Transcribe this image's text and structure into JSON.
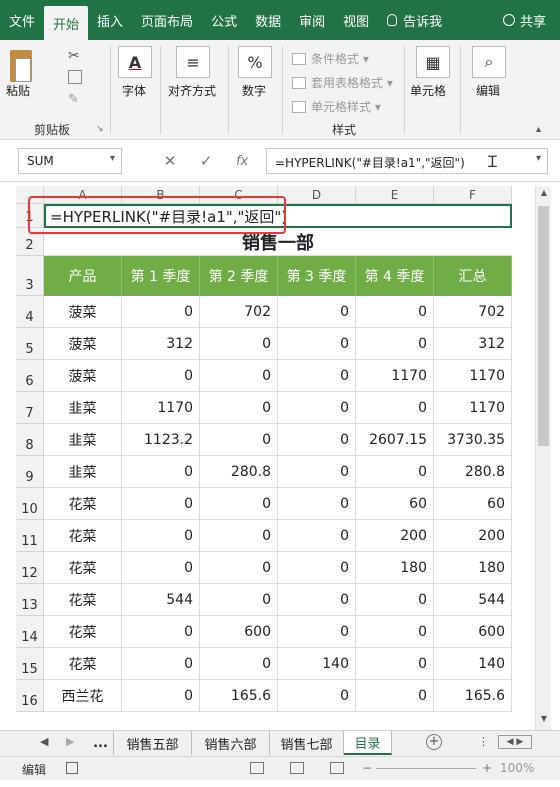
{
  "ribbon_tabs": [
    "文件",
    "开始",
    "插入",
    "页面布局",
    "公式",
    "数据",
    "审阅",
    "视图",
    "告诉我"
  ],
  "share_label": "共享",
  "ribbon": {
    "paste": "粘贴",
    "clipboard": "剪贴板",
    "font": "字体",
    "align": "对齐方式",
    "number": "数字",
    "number_symbol": "%",
    "cond_format": "条件格式",
    "table_format": "套用表格格式",
    "cell_style": "单元格样式",
    "styles": "样式",
    "cells": "单元格",
    "editing": "编辑"
  },
  "formula_bar": {
    "name_box": "SUM",
    "fx": "fx",
    "formula": "=HYPERLINK(\"#目录!a1\",\"返回\")"
  },
  "columns": [
    "A",
    "B",
    "C",
    "D",
    "E",
    "F"
  ],
  "row_numbers": [
    "1",
    "2",
    "3",
    "4",
    "5",
    "6",
    "7",
    "8",
    "9",
    "10",
    "11",
    "12",
    "13",
    "14",
    "15",
    "16"
  ],
  "row1_text": "=HYPERLINK(\"#目录!a1\",\"返回\")",
  "sheet_title": "销售一部",
  "table_headers": [
    "产品",
    "第 1 季度",
    "第 2 季度",
    "第 3 季度",
    "第 4 季度",
    "汇总"
  ],
  "rows": [
    [
      "菠菜",
      "0",
      "702",
      "0",
      "0",
      "702"
    ],
    [
      "菠菜",
      "312",
      "0",
      "0",
      "0",
      "312"
    ],
    [
      "菠菜",
      "0",
      "0",
      "0",
      "1170",
      "1170"
    ],
    [
      "韭菜",
      "1170",
      "0",
      "0",
      "0",
      "1170"
    ],
    [
      "韭菜",
      "1123.2",
      "0",
      "0",
      "2607.15",
      "3730.35"
    ],
    [
      "韭菜",
      "0",
      "280.8",
      "0",
      "0",
      "280.8"
    ],
    [
      "花菜",
      "0",
      "0",
      "0",
      "60",
      "60"
    ],
    [
      "花菜",
      "0",
      "0",
      "0",
      "200",
      "200"
    ],
    [
      "花菜",
      "0",
      "0",
      "0",
      "180",
      "180"
    ],
    [
      "花菜",
      "544",
      "0",
      "0",
      "0",
      "544"
    ],
    [
      "花菜",
      "0",
      "600",
      "0",
      "0",
      "600"
    ],
    [
      "花菜",
      "0",
      "0",
      "140",
      "0",
      "140"
    ],
    [
      "西兰花",
      "0",
      "165.6",
      "0",
      "0",
      "165.6"
    ]
  ],
  "sheet_tabs": [
    "...",
    "销售五部",
    "销售六部",
    "销售七部",
    "目录"
  ],
  "active_sheet": "目录",
  "status": {
    "mode": "编辑",
    "zoom_minus": "−",
    "zoom_plus": "+",
    "zoom_pct": "100%"
  },
  "colors": {
    "excel_green": "#217346",
    "header_green": "#70ad47",
    "highlight_red": "#e53a3a"
  }
}
